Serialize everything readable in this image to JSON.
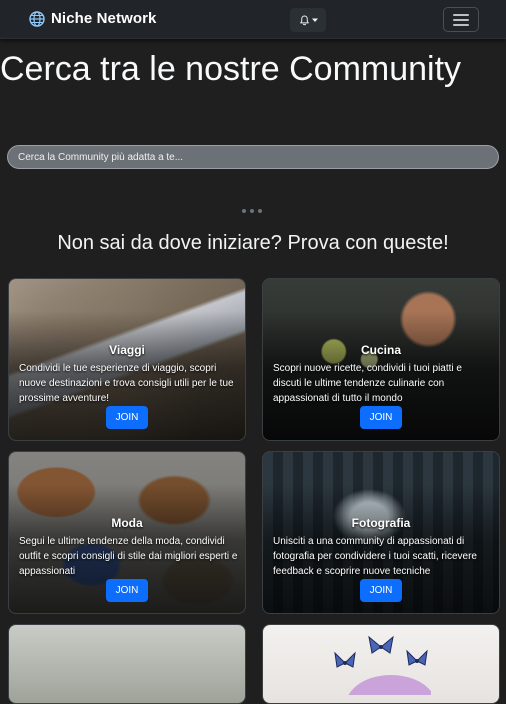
{
  "navbar": {
    "brand_name": "Niche Network",
    "brand_icon": "globe-icon",
    "notification_icon": "bell-icon",
    "menu_icon": "hamburger-icon"
  },
  "hero": {
    "title": "Cerca tra le nostre Community"
  },
  "search": {
    "placeholder": "Cerca la Community più adatta a te..."
  },
  "suggestions": {
    "title": "Non sai da dove iniziare? Prova con queste!"
  },
  "communities": [
    {
      "name": "Viaggi",
      "description": "Condividi le tue esperienze di viaggio, scopri nuove destinazioni e trova consigli utili per le tue prossime avventure!",
      "button": "JOIN"
    },
    {
      "name": "Cucina",
      "description": "Scopri nuove ricette, condividi i tuoi piatti e discuti le ultime tendenze culinarie con appassionati di tutto il mondo",
      "button": "JOIN"
    },
    {
      "name": "Moda",
      "description": "Segui le ultime tendenze della moda, condividi outfit e scopri consigli di stile dai migliori esperti e appassionati",
      "button": "JOIN"
    },
    {
      "name": "Fotografia",
      "description": "Unisciti a una community di appassionati di fotografia per condividere i tuoi scatti, ricevere feedback e scoprire nuove tecniche",
      "button": "JOIN"
    }
  ],
  "colors": {
    "background": "#1f1f1f",
    "navbar": "#212529",
    "accent": "#0d6efd"
  }
}
